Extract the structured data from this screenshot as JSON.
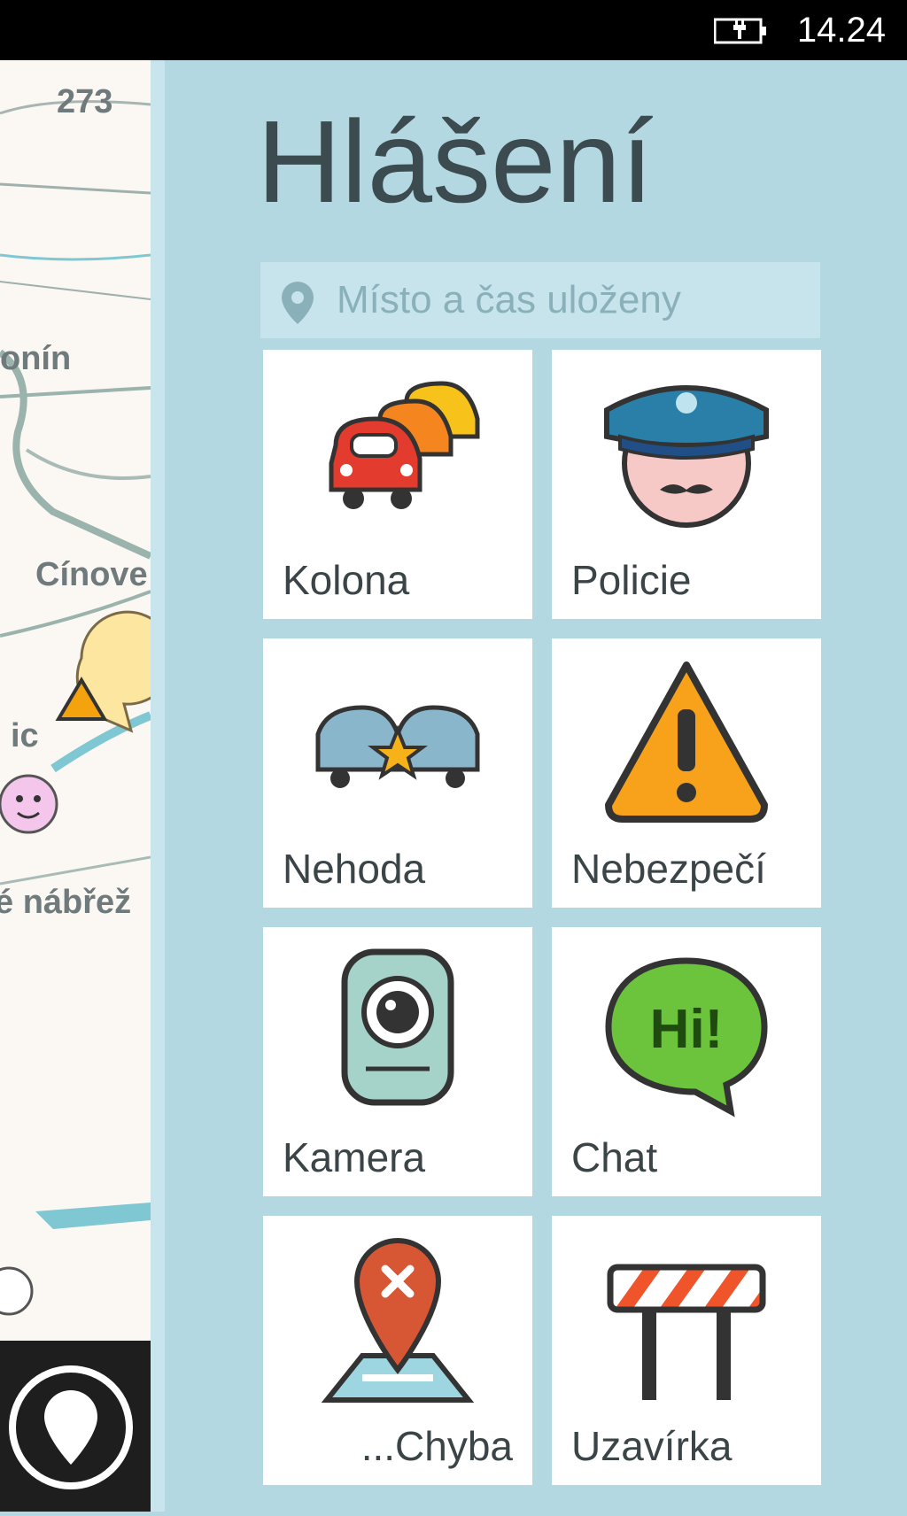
{
  "status_bar": {
    "time": "14.24",
    "battery_icon": "battery-charging-icon"
  },
  "map": {
    "labels": [
      "273",
      "onín",
      "Cínove",
      "ic",
      "é nábřež"
    ],
    "location_button_icon": "map-pin-icon"
  },
  "panel": {
    "title": "Hlášení",
    "location_text": "Místo a čas uloženy",
    "location_icon": "location-pin-icon"
  },
  "tiles": [
    {
      "label": "Kolona",
      "icon": "traffic-jam-icon"
    },
    {
      "label": "Policie",
      "icon": "police-icon"
    },
    {
      "label": "Nehoda",
      "icon": "accident-icon"
    },
    {
      "label": "Nebezpečí",
      "icon": "hazard-icon"
    },
    {
      "label": "Kamera",
      "icon": "camera-icon"
    },
    {
      "label": "Chat",
      "icon": "chat-icon"
    },
    {
      "label": "...Chyba",
      "icon": "map-error-icon"
    },
    {
      "label": "Uzavírka",
      "icon": "road-closure-icon"
    }
  ],
  "colors": {
    "panel_bg": "#b4d8e2",
    "tile_bg": "#ffffff",
    "title": "#3c4b4f",
    "accent_blue": "#2a7fa8"
  }
}
